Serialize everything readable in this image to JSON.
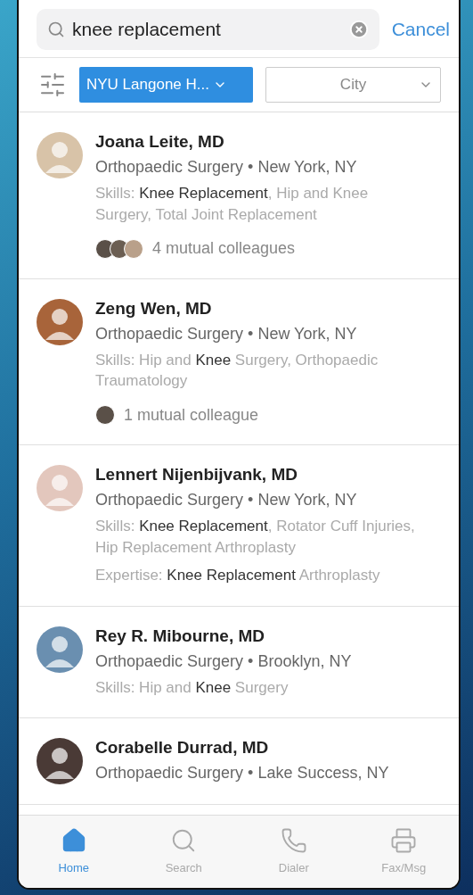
{
  "search": {
    "value": "knee replacement",
    "cancel": "Cancel"
  },
  "filters": [
    {
      "label": "NYU Langone H...",
      "selected": true
    },
    {
      "label": "City",
      "selected": false
    }
  ],
  "results": [
    {
      "name": "Joana Leite, MD",
      "subtitle": "Orthopaedic Surgery • New York, NY",
      "details": [
        {
          "label": "Skills:",
          "text": "**Knee Replacement**, Hip and Knee Surgery, Total Joint Replacement"
        }
      ],
      "mutual": {
        "kind": "group",
        "text": "4 mutual colleagues"
      }
    },
    {
      "name": "Zeng Wen, MD",
      "subtitle": "Orthopaedic Surgery • New York, NY",
      "details": [
        {
          "label": "Skills:",
          "text": "Hip and **Knee** Surgery, Orthopaedic Traumatology"
        }
      ],
      "mutual": {
        "kind": "single",
        "text": "1 mutual colleague"
      }
    },
    {
      "name": "Lennert Nijenbijvank, MD",
      "subtitle": "Orthopaedic Surgery • New York, NY",
      "details": [
        {
          "label": "Skills:",
          "text": "**Knee Replacement**, Rotator Cuff Injuries, Hip Replacement Arthroplasty"
        },
        {
          "label": "Expertise:",
          "text": "**Knee Replacement** Arthroplasty"
        }
      ]
    },
    {
      "name": "Rey R. Mibourne, MD",
      "subtitle": "Orthopaedic Surgery • Brooklyn, NY",
      "details": [
        {
          "label": "Skills:",
          "text": "Hip and **Knee** Surgery"
        }
      ]
    },
    {
      "name": "Corabelle Durrad, MD",
      "subtitle": "Orthopaedic Surgery • Lake Success, NY"
    }
  ],
  "tabs": [
    {
      "label": "Home",
      "selected": true
    },
    {
      "label": "Search",
      "selected": false
    },
    {
      "label": "Dialer",
      "selected": false
    },
    {
      "label": "Fax/Msg",
      "selected": false
    }
  ]
}
